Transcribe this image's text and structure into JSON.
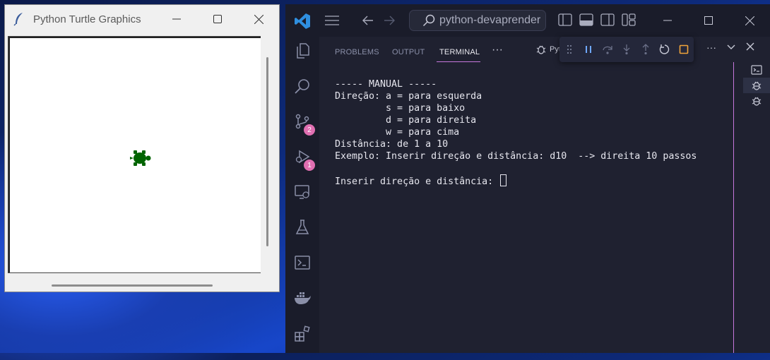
{
  "turtle_window": {
    "title": "Python Turtle Graphics",
    "icon": "feather-icon",
    "turtle_color": "#006400"
  },
  "vscode": {
    "search_text": "python-devaprender",
    "accent": "#c678dd",
    "badges": {
      "source_control": "2",
      "run_debug": "1"
    },
    "panel_tabs": [
      {
        "label": "PROBLEMS"
      },
      {
        "label": "OUTPUT"
      },
      {
        "label": "TERMINAL"
      }
    ],
    "panel_more": "···",
    "debug_label": "Pyth",
    "terminal_lines": [
      "----- MANUAL -----",
      "Direção: a = para esquerda",
      "         s = para baixo",
      "         d = para direita",
      "         w = para cima",
      "Distância: de 1 a 10",
      "Exemplo: Inserir direção e distância: d10  --> direita 10 passos",
      "",
      "Inserir direção e distância: "
    ]
  }
}
